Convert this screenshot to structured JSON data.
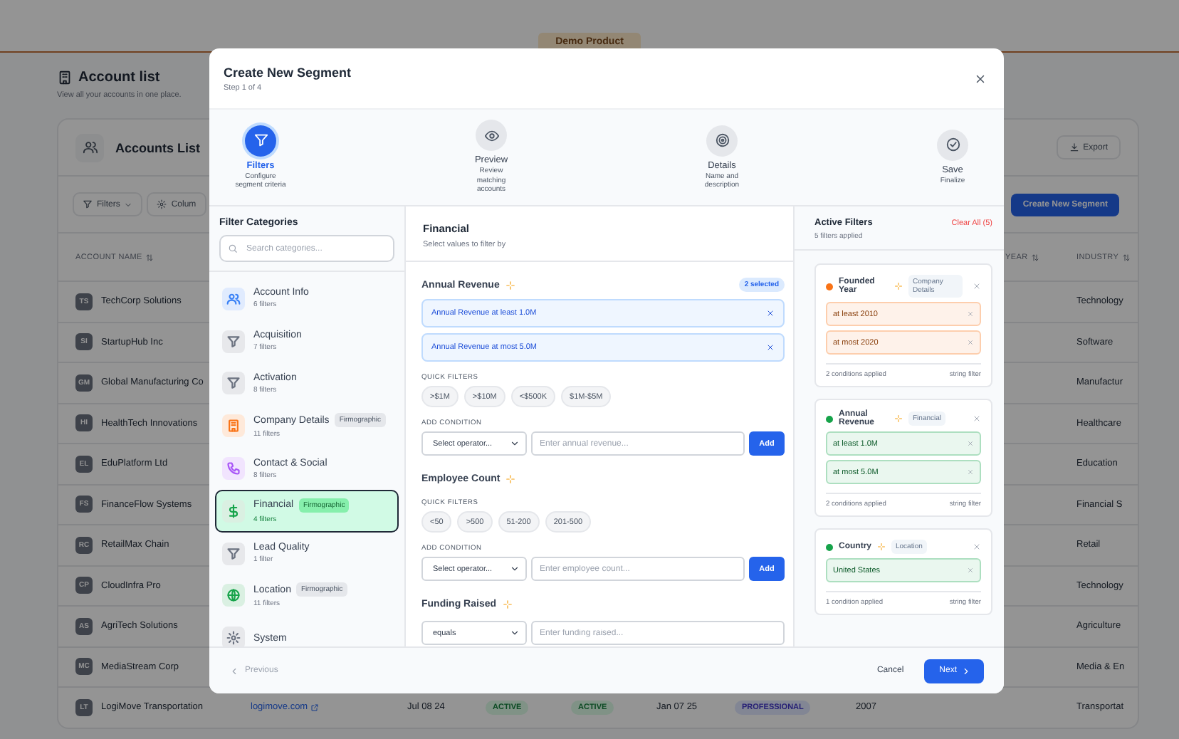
{
  "top_bar": {
    "product": "Demo Product"
  },
  "page": {
    "title": "Account list",
    "subtitle": "View all your accounts in one place."
  },
  "card": {
    "title": "Accounts List",
    "export_button": "Export",
    "filters_button": "Filters",
    "columns_button": "Colum",
    "create_button": "Create New Segment"
  },
  "table": {
    "columns": [
      {
        "label": "ACCOUNT NAME"
      },
      {
        "label": "YEAR"
      },
      {
        "label": "INDUSTRY"
      }
    ],
    "rows": [
      {
        "initials": "TS",
        "name": "TechCorp Solutions",
        "industry": "Technology"
      },
      {
        "initials": "SI",
        "name": "StartupHub Inc",
        "industry": "Software"
      },
      {
        "initials": "GM",
        "name": "Global Manufacturing Co",
        "industry": "Manufactur"
      },
      {
        "initials": "HI",
        "name": "HealthTech Innovations",
        "industry": "Healthcare"
      },
      {
        "initials": "EL",
        "name": "EduPlatform Ltd",
        "industry": "Education"
      },
      {
        "initials": "FS",
        "name": "FinanceFlow Systems",
        "industry": "Financial S"
      },
      {
        "initials": "RC",
        "name": "RetailMax Chain",
        "industry": "Retail"
      },
      {
        "initials": "CP",
        "name": "CloudInfra Pro",
        "industry": "Technology"
      },
      {
        "initials": "AS",
        "name": "AgriTech Solutions",
        "industry": "Agriculture"
      },
      {
        "initials": "MC",
        "name": "MediaStream Corp",
        "industry": "Media & En"
      },
      {
        "initials": "LT",
        "name": "LogiMove Transportation",
        "industry": "Transportat",
        "cells": [
          {
            "kind": "link",
            "text": "logimove.com"
          },
          {
            "kind": "text",
            "text": "Jul 08 24"
          },
          {
            "kind": "status",
            "text": "ACTIVE"
          },
          {
            "kind": "status",
            "text": "ACTIVE"
          },
          {
            "kind": "text",
            "text": "Jan 07 25"
          },
          {
            "kind": "plan",
            "text": "PROFESSIONAL"
          },
          {
            "kind": "text",
            "text": "2007"
          }
        ]
      }
    ]
  },
  "modal": {
    "title": "Create New Segment",
    "step_text": "Step 1 of 4",
    "steps": [
      {
        "label": "Filters",
        "description": "Configure segment criteria",
        "selected": true
      },
      {
        "label": "Preview",
        "description": "Review matching accounts",
        "selected": false
      },
      {
        "label": "Details",
        "description": "Name and description",
        "selected": false
      },
      {
        "label": "Save",
        "description": "Finalize",
        "selected": false
      }
    ],
    "categories": {
      "title": "Filter Categories",
      "search_placeholder": "Search categories...",
      "items": [
        {
          "name": "Account Info",
          "count": "6 filters",
          "color": "#3b82f6",
          "selected": false
        },
        {
          "name": "Acquisition",
          "count": "7 filters",
          "color": "#6b7280",
          "selected": false
        },
        {
          "name": "Activation",
          "count": "8 filters",
          "color": "#6b7280",
          "selected": false
        },
        {
          "name": "Company Details",
          "count": "11 filters",
          "badge": "Firmographic",
          "color": "#f97316",
          "selected": false
        },
        {
          "name": "Contact & Social",
          "count": "8 filters",
          "color": "#a855f7",
          "selected": false
        },
        {
          "name": "Financial",
          "count": "4 filters",
          "badge": "Firmographic",
          "color": "#16a34a",
          "selected": true
        },
        {
          "name": "Lead Quality",
          "count": "1 filter",
          "color": "#6b7280",
          "selected": false
        },
        {
          "name": "Location",
          "count": "11 filters",
          "badge": "Firmographic",
          "color": "#16a34a",
          "selected": false
        },
        {
          "name": "System",
          "color": "#6b7280",
          "selected": false
        }
      ]
    },
    "detail": {
      "title": "Financial",
      "subtitle": "Select values to filter by",
      "sections": [
        {
          "name": "Annual Revenue",
          "badge": "2 selected",
          "conditions": [
            "Annual Revenue at least 1.0M",
            "Annual Revenue at most 5.0M"
          ],
          "quick_label": "QUICK FILTERS",
          "quick_filters": [
            ">$1M",
            ">$10M",
            "<$500K",
            "$1M-$5M"
          ],
          "add_label": "ADD CONDITION",
          "operator_placeholder": "Select operator...",
          "input_placeholder": "Enter annual revenue...",
          "add_button": "Add"
        },
        {
          "name": "Employee Count",
          "quick_label": "QUICK FILTERS",
          "quick_filters": [
            "<50",
            ">500",
            "51-200",
            "201-500"
          ],
          "add_label": "ADD CONDITION",
          "operator_placeholder": "Select operator...",
          "input_placeholder": "Enter employee count...",
          "add_button": "Add"
        },
        {
          "name": "Funding Raised",
          "operator_value": "equals",
          "input_placeholder": "Enter funding raised..."
        }
      ]
    },
    "active": {
      "title": "Active Filters",
      "clear_button": "Clear All (5)",
      "summary": "5 filters applied",
      "filters": [
        {
          "name": "Founded Year",
          "category": "Company Details",
          "color": "#f97316",
          "conditions": [
            "at least 2010",
            "at most 2020"
          ],
          "applied": "2 conditions applied",
          "type": "string filter"
        },
        {
          "name": "Annual Revenue",
          "category": "Financial",
          "color": "#16a34a",
          "conditions": [
            "at least 1.0M",
            "at most 5.0M"
          ],
          "applied": "2 conditions applied",
          "type": "string filter"
        },
        {
          "name": "Country",
          "category": "Location",
          "color": "#16a34a",
          "conditions": [
            "United States"
          ],
          "applied": "1 condition applied",
          "type": "string filter"
        }
      ]
    },
    "footer": {
      "previous": {
        "label": "Previous",
        "disabled": true
      },
      "cancel": "Cancel",
      "next": "Next"
    }
  }
}
